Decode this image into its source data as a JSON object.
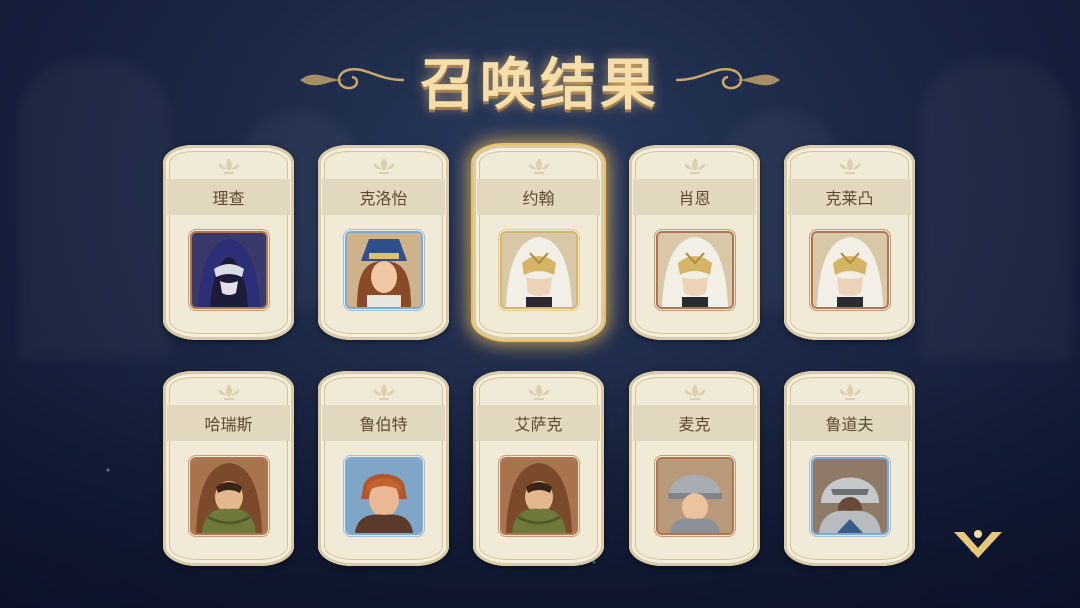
{
  "screen": {
    "title": "召唤结果"
  },
  "results": [
    {
      "name": "理查",
      "portrait": "hooded-masked-purple-icon",
      "frame": "copper",
      "selected": false
    },
    {
      "name": "克洛怡",
      "portrait": "blue-hat-woman-icon",
      "frame": "blue",
      "selected": false
    },
    {
      "name": "约翰",
      "portrait": "white-hood-gold-mask-icon",
      "frame": "gold",
      "selected": true
    },
    {
      "name": "肖恩",
      "portrait": "white-hood-gold-mask-icon",
      "frame": "copper",
      "selected": false
    },
    {
      "name": "克莱凸",
      "portrait": "white-hood-gold-mask-icon",
      "frame": "copper",
      "selected": false
    },
    {
      "name": "哈瑞斯",
      "portrait": "brown-hood-green-scarf-icon",
      "frame": "copper",
      "selected": false
    },
    {
      "name": "鲁伯特",
      "portrait": "red-haired-man-icon",
      "frame": "blue",
      "selected": false
    },
    {
      "name": "艾萨克",
      "portrait": "brown-hood-green-scarf-icon",
      "frame": "copper",
      "selected": false
    },
    {
      "name": "麦克",
      "portrait": "steel-helmet-soldier-icon",
      "frame": "copper",
      "selected": false
    },
    {
      "name": "鲁道夫",
      "portrait": "armored-knight-icon",
      "frame": "blue",
      "selected": false
    }
  ],
  "continue_button": {
    "icon": "chevron-down-icon"
  },
  "colors": {
    "card_bg": "#f1ead6",
    "title": "#f6deaa",
    "highlight": "#e9c15f",
    "background": "#1b2744"
  }
}
